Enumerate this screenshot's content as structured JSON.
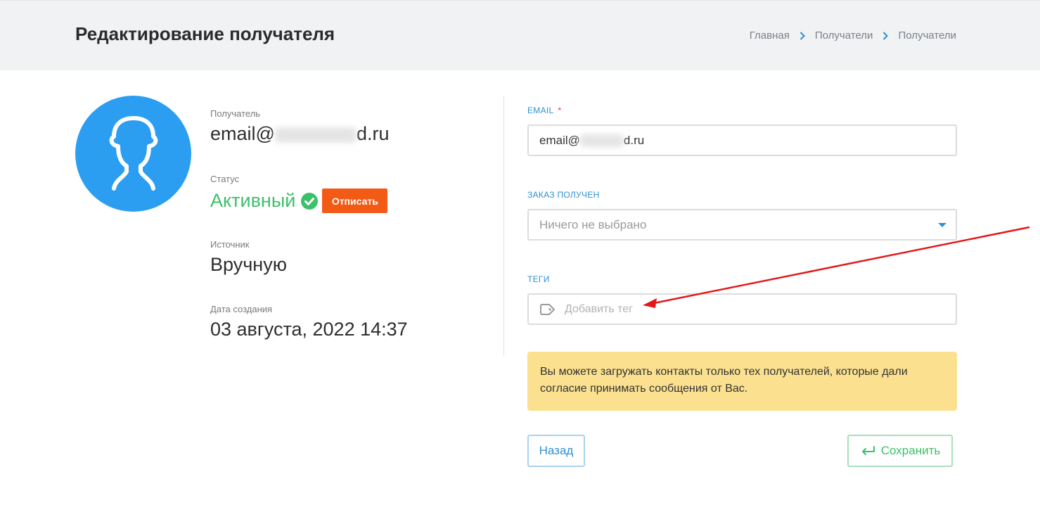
{
  "header": {
    "title": "Редактирование получателя",
    "breadcrumb": [
      "Главная",
      "Получатели",
      "Получатели"
    ]
  },
  "profile": {
    "recipient_label": "Получатель",
    "email_prefix": "email@",
    "email_suffix": "d.ru",
    "status_label": "Статус",
    "status_value": "Активный",
    "unsubscribe_button": "Отписать",
    "source_label": "Источник",
    "source_value": "Вручную",
    "created_label": "Дата создания",
    "created_value": "03 августа, 2022 14:37"
  },
  "form": {
    "email_label": "EMAIL",
    "email_required_mark": "*",
    "email_prefix": "email@",
    "email_suffix": "d.ru",
    "order_label": "ЗАКАЗ ПОЛУЧЕН",
    "order_selected": "Ничего не выбрано",
    "tags_label": "ТЕГИ",
    "tags_placeholder": "Добавить тег"
  },
  "notice": {
    "text": "Вы можете загружать контакты только тех получателей, которые дали согласие принимать сообщения от Вас."
  },
  "actions": {
    "back_label": "Назад",
    "save_label": "Сохранить"
  },
  "colors": {
    "accent_blue": "#2e8fd6",
    "status_green": "#3cc06a",
    "unsubscribe_orange": "#f25a16",
    "notice_yellow": "#fbe08f",
    "annotation_red": "#e31919"
  },
  "icons": {
    "avatar": "user-silhouette-icon",
    "breadcrumb_separator": "chevron-right-icon",
    "status": "check-circle-icon",
    "tags_field": "tag-icon",
    "select": "caret-down-icon",
    "save": "return-arrow-icon"
  }
}
